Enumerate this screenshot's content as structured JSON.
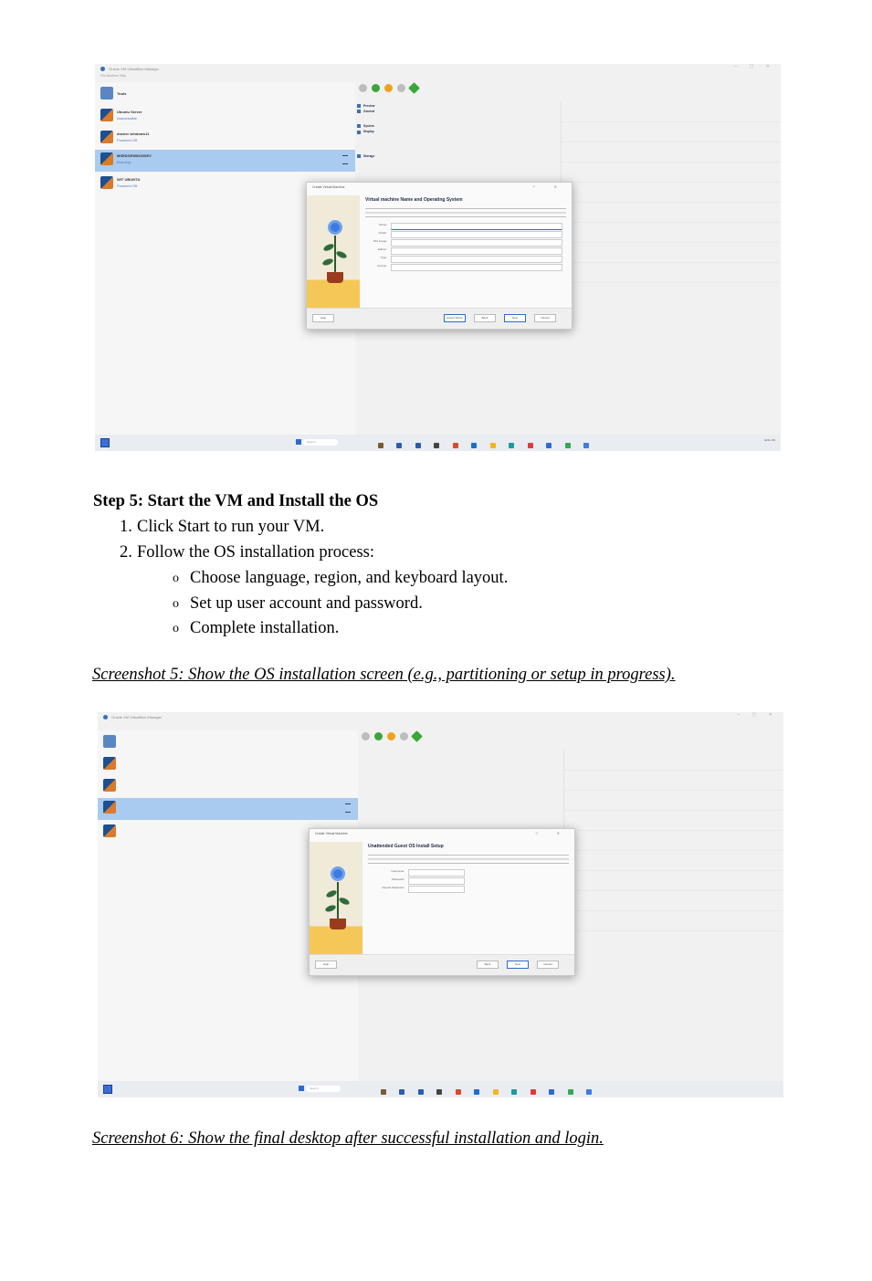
{
  "screenshot1": {
    "window_title": "Oracle VM VirtualBox Manager",
    "menu": "File   Machine   Help",
    "tools_label": "Tools",
    "vms": [
      {
        "name": "Ubuntu Server",
        "state": "Inaccessible"
      },
      {
        "name": "docker windows11",
        "state": "Powered Off"
      },
      {
        "name": "MSEDGEWIN10DEV",
        "state": "Running"
      },
      {
        "name": "WIT UBUNTU",
        "state": "Powered Off"
      }
    ],
    "toolbar": [
      "New",
      "Add",
      "Settings",
      "Discard",
      "Show"
    ],
    "details": [
      "Preview",
      "General",
      "System",
      "Display",
      "Storage"
    ],
    "dialog_title": "Create Virtual Machine",
    "dialog_heading": "Virtual machine Name and Operating System",
    "fields": [
      "Name:",
      "Folder:",
      "ISO Image:",
      "Edition:",
      "Type:",
      "Version:"
    ],
    "buttons": [
      "Expert Mode",
      "Back",
      "Next",
      "Cancel"
    ],
    "help": "Help",
    "search": "Search",
    "clock": "ENG US"
  },
  "heading": "Step 5: Start the VM and Install the OS",
  "steps": [
    {
      "num": "1.",
      "text": "Click Start to run your VM."
    },
    {
      "num": "2.",
      "text": "Follow the OS installation process:"
    }
  ],
  "substeps": [
    {
      "mark": "o",
      "text": "Choose language, region, and keyboard layout."
    },
    {
      "mark": "o",
      "text": "Set up user account and password."
    },
    {
      "mark": "o",
      "text": "Complete installation."
    }
  ],
  "caption5": "Screenshot 5: Show the OS installation screen (e.g., partitioning or setup in progress).",
  "screenshot2": {
    "window_title": "Oracle VM VirtualBox Manager",
    "dialog_title": "Create Virtual Machine",
    "dialog_heading": "Unattended Guest OS Install Setup",
    "fields": [
      "Username:",
      "Password:",
      "Repeat Password:"
    ],
    "buttons": [
      "Back",
      "Next",
      "Cancel"
    ],
    "help": "Help",
    "search": "Search"
  },
  "caption6": "Screenshot 6: Show the final desktop after successful installation and login."
}
